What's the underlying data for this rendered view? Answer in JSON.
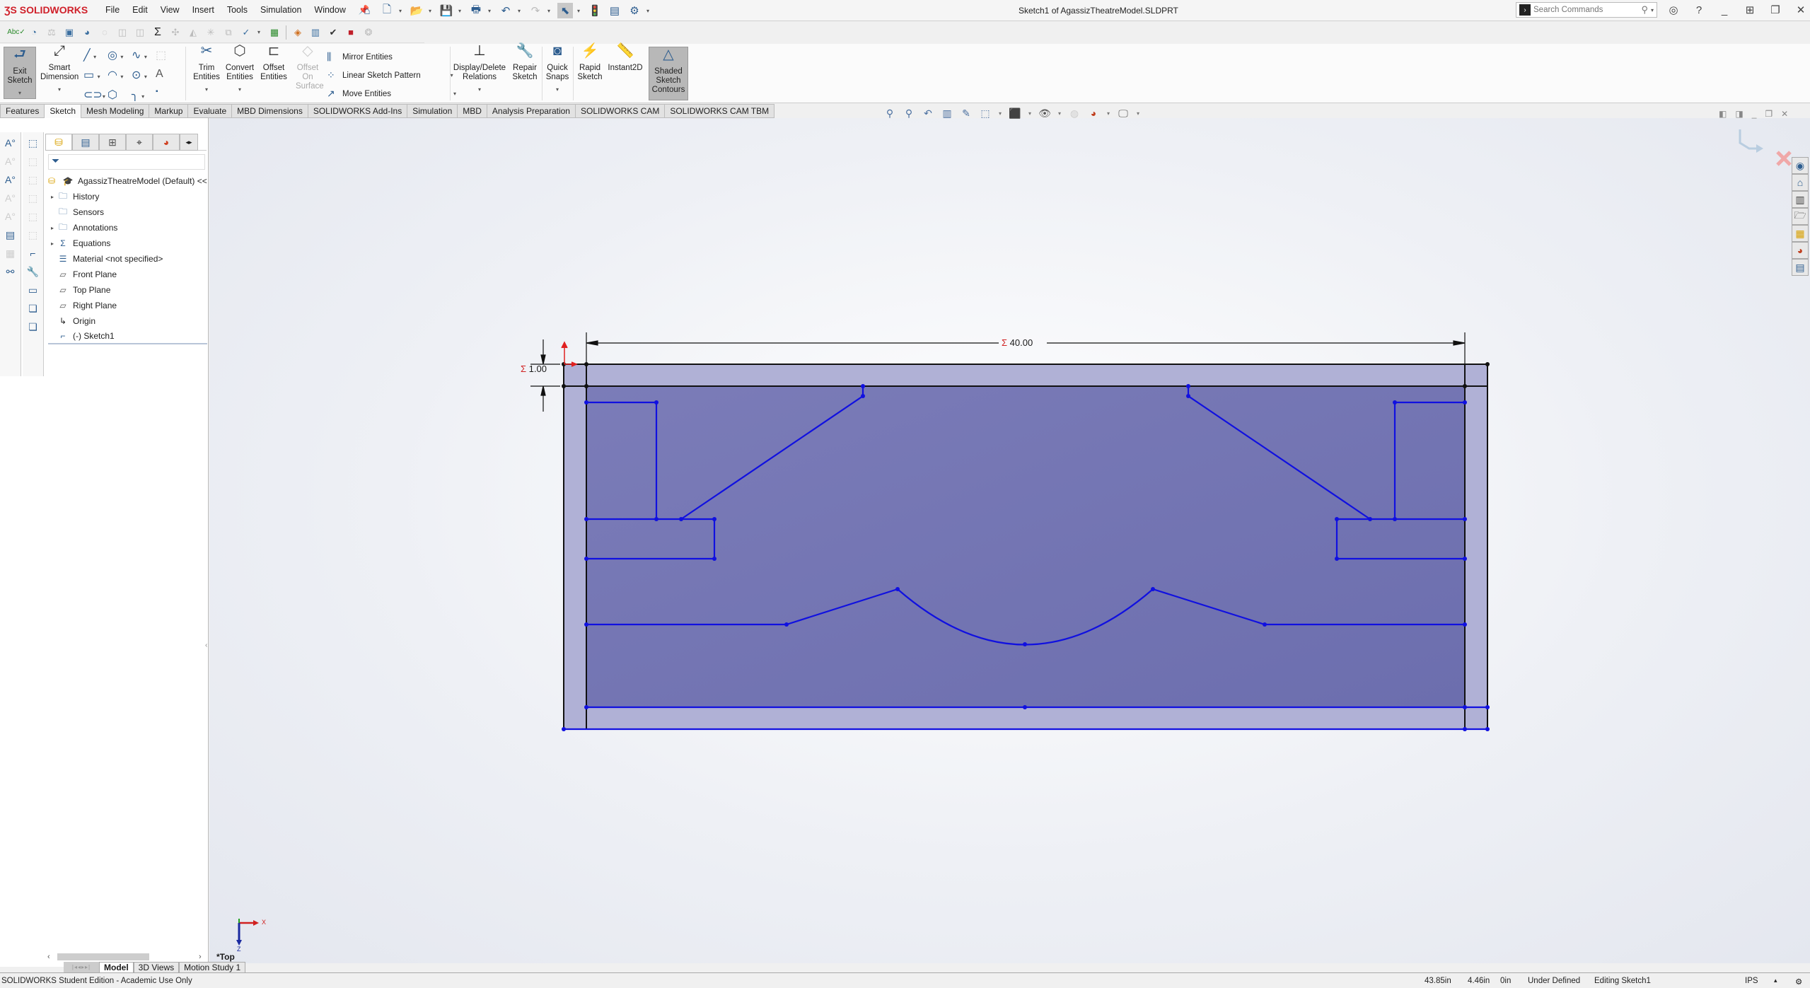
{
  "app": {
    "brand": "SOLIDWORKS",
    "window_title": "Sketch1 of AgassizTheatreModel.SLDPRT",
    "menu": [
      "File",
      "Edit",
      "View",
      "Insert",
      "Tools",
      "Simulation",
      "Window"
    ],
    "search": {
      "placeholder": "Search Commands"
    }
  },
  "ribbon": {
    "exit_sketch": "Exit Sketch",
    "smart_dimension": "Smart Dimension",
    "trim_entities": "Trim Entities",
    "convert_entities": "Convert Entities",
    "offset_entities": "Offset Entities",
    "offset_on_surface": "Offset On Surface",
    "mirror_entities": "Mirror Entities",
    "linear_sketch_pattern": "Linear Sketch Pattern",
    "move_entities": "Move Entities",
    "display_delete_relations": "Display/Delete Relations",
    "repair_sketch": "Repair Sketch",
    "quick_snaps": "Quick Snaps",
    "rapid_sketch": "Rapid Sketch",
    "instant2d": "Instant2D",
    "shaded_sketch_contours": "Shaded Sketch Contours"
  },
  "command_tabs": [
    "Features",
    "Sketch",
    "Mesh Modeling",
    "Markup",
    "Evaluate",
    "MBD Dimensions",
    "SOLIDWORKS Add-Ins",
    "Simulation",
    "MBD",
    "Analysis Preparation",
    "SOLIDWORKS CAM",
    "SOLIDWORKS CAM TBM"
  ],
  "active_tab": "Sketch",
  "feature_tree": {
    "root": "AgassizTheatreModel (Default) <<",
    "items": [
      {
        "label": "History",
        "icon": "history-folder-icon",
        "expandable": true
      },
      {
        "label": "Sensors",
        "icon": "sensors-folder-icon",
        "expandable": false
      },
      {
        "label": "Annotations",
        "icon": "annotations-folder-icon",
        "expandable": true
      },
      {
        "label": "Equations",
        "icon": "equations-folder-icon",
        "expandable": true
      },
      {
        "label": "Material <not specified>",
        "icon": "material-icon",
        "expandable": false
      },
      {
        "label": "Front Plane",
        "icon": "plane-icon",
        "expandable": false
      },
      {
        "label": "Top Plane",
        "icon": "plane-icon",
        "expandable": false
      },
      {
        "label": "Right Plane",
        "icon": "plane-icon",
        "expandable": false
      },
      {
        "label": "Origin",
        "icon": "origin-icon",
        "expandable": false
      },
      {
        "label": "(-) Sketch1",
        "icon": "sketch-icon",
        "expandable": false
      }
    ]
  },
  "sketch": {
    "dimension_width": "40.00",
    "dimension_offset": "1.00",
    "dimension_symbol": "Σ"
  },
  "viewport": {
    "view_label": "*Top",
    "triad_x": "X",
    "triad_z": "Z"
  },
  "bottom_tabs": [
    "Model",
    "3D Views",
    "Motion Study 1"
  ],
  "status": {
    "edition": "SOLIDWORKS Student Edition - Academic Use Only",
    "x": "43.85in",
    "y": "4.46in",
    "z": "0in",
    "state": "Under Defined",
    "mode": "Editing Sketch1",
    "units": "IPS"
  }
}
